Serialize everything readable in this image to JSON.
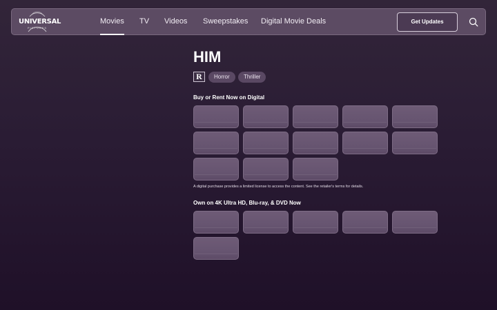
{
  "header": {
    "logo": {
      "word": "UNIVERSAL",
      "sub": "PICTURES"
    },
    "nav": [
      {
        "label": "Movies",
        "active": true
      },
      {
        "label": "TV",
        "active": false
      },
      {
        "label": "Videos",
        "active": false
      },
      {
        "label": "Sweepstakes",
        "active": false
      },
      {
        "label": "Digital Movie Deals",
        "active": false
      }
    ],
    "cta_label": "Get Updates",
    "search_icon": "search-icon"
  },
  "movie": {
    "title": "HIM",
    "rating": "R",
    "genres": [
      "Horror",
      "Thriller"
    ]
  },
  "digital": {
    "heading": "Buy or Rent Now on Digital",
    "retailer_count": 13,
    "disclaimer": "A digital purchase provides a limited license to access the content. See the retailer's terms for details."
  },
  "physical": {
    "heading": "Own on 4K Ultra HD, Blu-ray, & DVD Now",
    "retailer_count": 6
  },
  "colors": {
    "background_top": "#322539",
    "background_bottom": "#1f1028",
    "nav_bg": "#5c4b63",
    "tile_bg": "#6e5b76",
    "chip_bg": "#5a4863"
  }
}
